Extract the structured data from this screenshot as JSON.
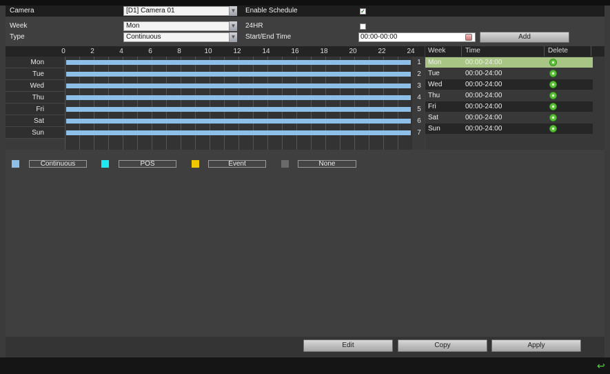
{
  "form": {
    "camera_label": "Camera",
    "camera_value": "[D1] Camera 01",
    "enable_schedule_label": "Enable Schedule",
    "enable_schedule_checked": true,
    "week_label": "Week",
    "week_value": "Mon",
    "hr24_label": "24HR",
    "hr24_checked": false,
    "type_label": "Type",
    "type_value": "Continuous",
    "start_end_label": "Start/End Time",
    "start_end_value": "00:00-00:00",
    "add_label": "Add"
  },
  "timeline": {
    "hour_labels": [
      "0",
      "2",
      "4",
      "6",
      "8",
      "10",
      "12",
      "14",
      "16",
      "18",
      "20",
      "22",
      "24"
    ],
    "days": [
      {
        "name": "Mon",
        "num": "1"
      },
      {
        "name": "Tue",
        "num": "2"
      },
      {
        "name": "Wed",
        "num": "3"
      },
      {
        "name": "Thu",
        "num": "4"
      },
      {
        "name": "Fri",
        "num": "5"
      },
      {
        "name": "Sat",
        "num": "6"
      },
      {
        "name": "Sun",
        "num": "7"
      }
    ],
    "bar_color": "#8ebfe9"
  },
  "schedule_list": {
    "headers": [
      "Week",
      "Time",
      "Delete"
    ],
    "rows": [
      {
        "week": "Mon",
        "time": "00:00-24:00"
      },
      {
        "week": "Tue",
        "time": "00:00-24:00"
      },
      {
        "week": "Wed",
        "time": "00:00-24:00"
      },
      {
        "week": "Thu",
        "time": "00:00-24:00"
      },
      {
        "week": "Fri",
        "time": "00:00-24:00"
      },
      {
        "week": "Sat",
        "time": "00:00-24:00"
      },
      {
        "week": "Sun",
        "time": "00:00-24:00"
      }
    ],
    "selected_color": "#a8c585"
  },
  "legend": [
    {
      "label": "Continuous",
      "color": "#8ebfe9"
    },
    {
      "label": "POS",
      "color": "#20e8f0"
    },
    {
      "label": "Event",
      "color": "#f0c800"
    },
    {
      "label": "None",
      "color": "#6a6a6a"
    }
  ],
  "buttons": {
    "edit": "Edit",
    "copy": "Copy",
    "apply": "Apply"
  }
}
